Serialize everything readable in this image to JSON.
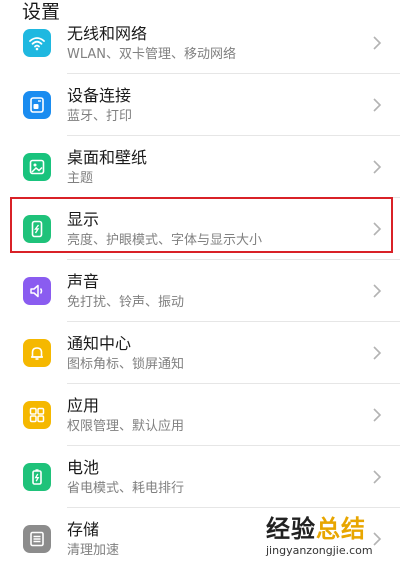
{
  "header": {
    "title": "设置"
  },
  "items": [
    {
      "title": "无线和网络",
      "subtitle": "WLAN、双卡管理、移动网络",
      "icon": "wifi-icon",
      "color": "#1fb8e0"
    },
    {
      "title": "设备连接",
      "subtitle": "蓝牙、打印",
      "icon": "device-connection-icon",
      "color": "#1a8cf0"
    },
    {
      "title": "桌面和壁纸",
      "subtitle": "主题",
      "icon": "wallpaper-icon",
      "color": "#19c37d"
    },
    {
      "title": "显示",
      "subtitle": "亮度、护眼模式、字体与显示大小",
      "icon": "display-icon",
      "color": "#1fc27a"
    },
    {
      "title": "声音",
      "subtitle": "免打扰、铃声、振动",
      "icon": "sound-icon",
      "color": "#8a5cf0"
    },
    {
      "title": "通知中心",
      "subtitle": "图标角标、锁屏通知",
      "icon": "bell-icon",
      "color": "#f5b800"
    },
    {
      "title": "应用",
      "subtitle": "权限管理、默认应用",
      "icon": "apps-icon",
      "color": "#f5b800"
    },
    {
      "title": "电池",
      "subtitle": "省电模式、耗电排行",
      "icon": "battery-icon",
      "color": "#1fc27a"
    },
    {
      "title": "存储",
      "subtitle": "清理加速",
      "icon": "storage-icon",
      "color": "#8c8c8c"
    }
  ],
  "watermark": {
    "main_a": "经验",
    "main_b": "总结",
    "url": "jingyanzongjie.com"
  }
}
